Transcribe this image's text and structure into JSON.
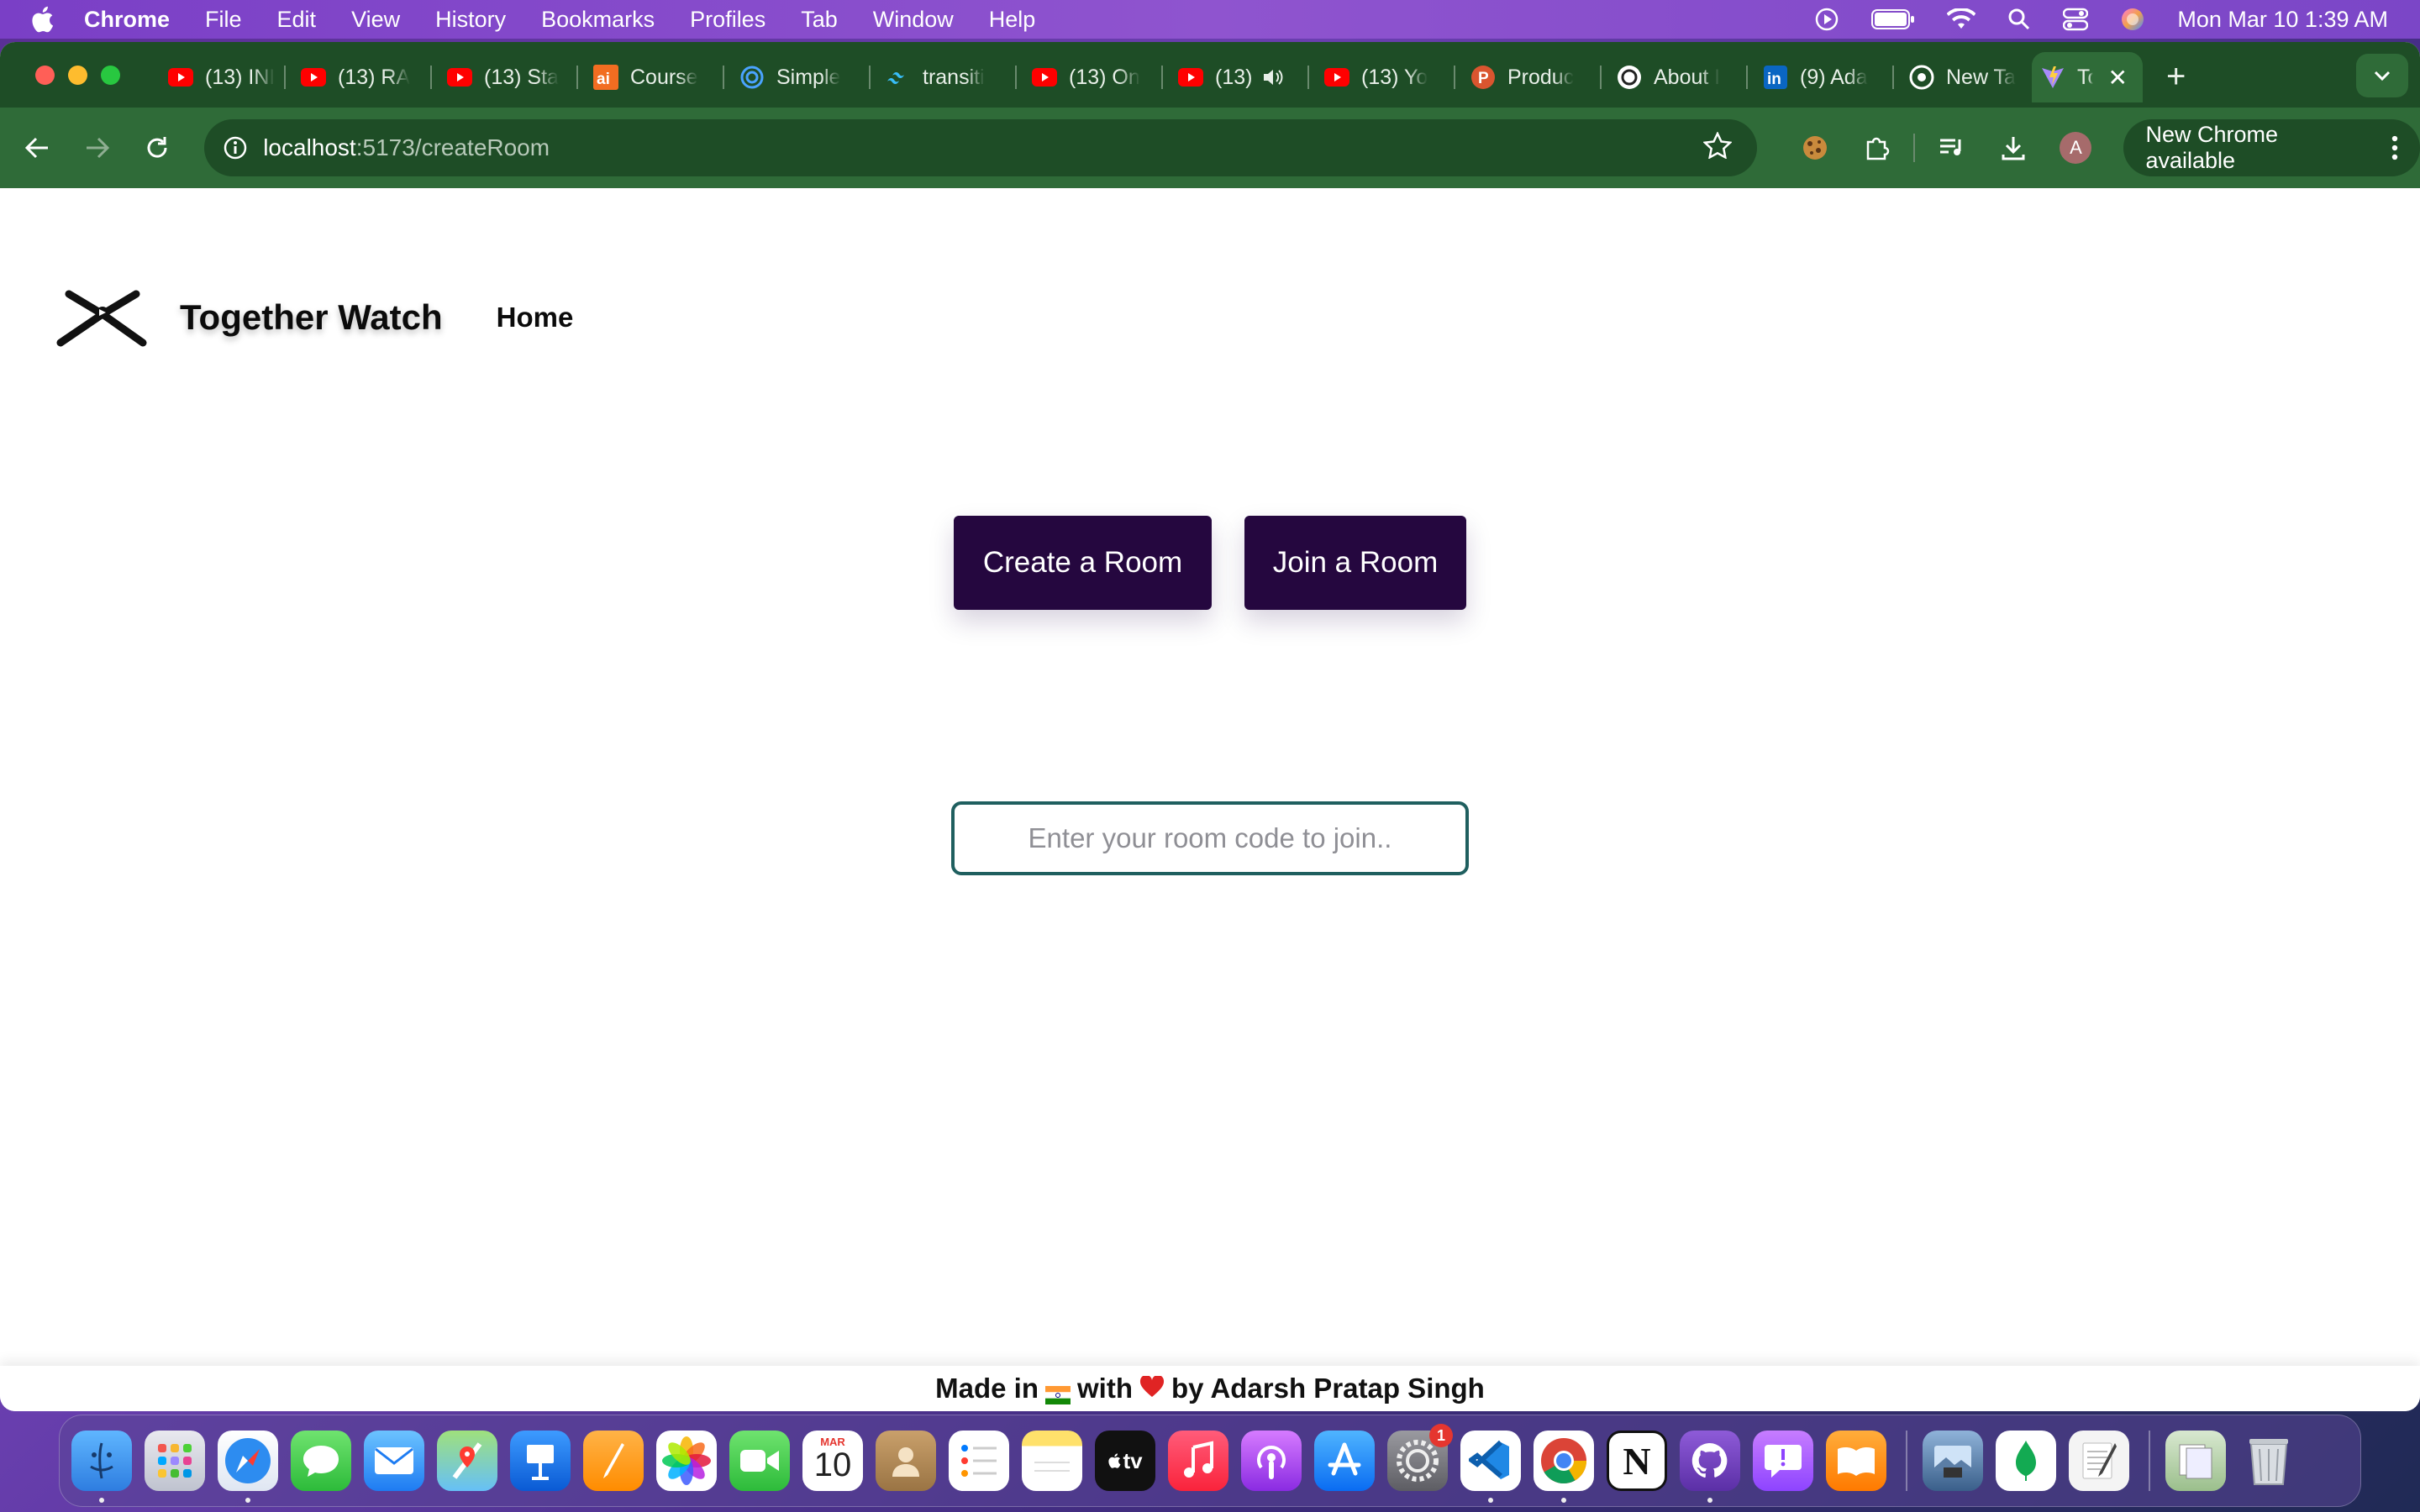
{
  "menubar": {
    "app_name": "Chrome",
    "menus": [
      "File",
      "Edit",
      "View",
      "History",
      "Bookmarks",
      "Profiles",
      "Tab",
      "Window",
      "Help"
    ],
    "clock": "Mon Mar 10  1:39 AM"
  },
  "browser": {
    "tabs": [
      {
        "label": "(13) INI",
        "icon": "youtube-icon"
      },
      {
        "label": "(13) RA",
        "icon": "youtube-icon"
      },
      {
        "label": "(13) Sta",
        "icon": "youtube-icon"
      },
      {
        "label": "Course",
        "icon": "ai-icon"
      },
      {
        "label": "Simple",
        "icon": "openai-icon"
      },
      {
        "label": "transiti",
        "icon": "tailwind-icon"
      },
      {
        "label": "(13) On",
        "icon": "youtube-icon"
      },
      {
        "label": "(13)",
        "icon": "youtube-icon"
      },
      {
        "label": "(13) Yo",
        "icon": "youtube-icon"
      },
      {
        "label": "Produc",
        "icon": "producthunt-icon"
      },
      {
        "label": "About I",
        "icon": "openai-icon"
      },
      {
        "label": "(9) Ada",
        "icon": "linkedin-icon"
      },
      {
        "label": "New Ta",
        "icon": "chrome-icon"
      },
      {
        "label": "Tog",
        "icon": "vite-icon"
      }
    ],
    "address": {
      "host": "localhost",
      "path": ":5173/createRoom"
    },
    "update_label": "New Chrome available",
    "profile_initial": "A"
  },
  "site": {
    "title": "Together Watch",
    "nav_home": "Home",
    "create_button": "Create a Room",
    "join_button": "Join a Room",
    "room_input": {
      "placeholder": "Enter your room code to join..",
      "value": ""
    },
    "footer": {
      "made_in": "Made in",
      "with": "with",
      "by": "by Adarsh Pratap Singh"
    }
  },
  "dock": {
    "apps": [
      "finder",
      "launchpad",
      "safari",
      "messages",
      "mail",
      "maps",
      "keynote",
      "pages",
      "photos",
      "facetime",
      "calendar",
      "contacts",
      "reminders",
      "notes",
      "tv",
      "music",
      "podcasts",
      "app-store",
      "system-settings",
      "vscode",
      "chrome",
      "notion",
      "github-desktop",
      "feedback",
      "books"
    ],
    "calendar_month": "MAR",
    "calendar_day": "10",
    "tv_label": "tv",
    "settings_badge": "1"
  }
}
